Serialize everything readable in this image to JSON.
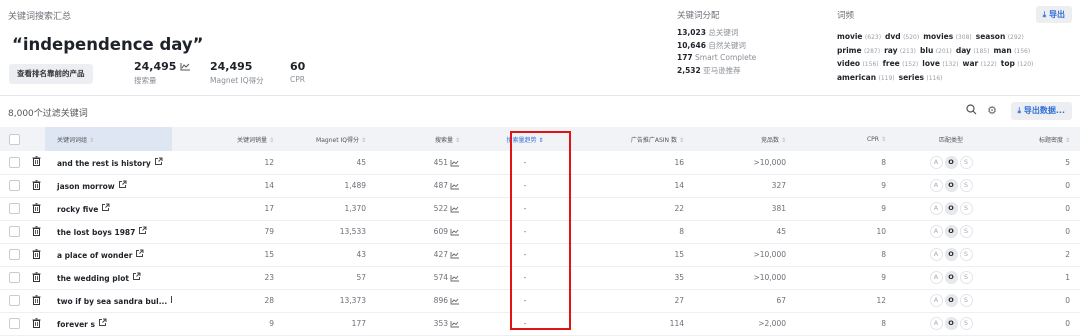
{
  "summary": {
    "title": "关键词搜索汇总",
    "keyword": "“independence day”",
    "top_products_label": "查看排名靠前的产品",
    "search_volume": {
      "value": "24,495",
      "label": "搜索量"
    },
    "magnet_iq": {
      "value": "24,495",
      "label": "Magnet IQ得分"
    },
    "cpr": {
      "value": "60",
      "label": "CPR"
    }
  },
  "distribution": {
    "title": "关键词分配",
    "total": {
      "num": "13,023",
      "text": "总关键词"
    },
    "organic": {
      "num": "10,646",
      "text": "自然关键词"
    },
    "smart": {
      "num": "177",
      "text": "Smart Complete"
    },
    "amazon": {
      "num": "2,532",
      "text": "亚马逊推荐"
    }
  },
  "frequency": {
    "title": "词频",
    "export_label": "导出",
    "rows": [
      [
        {
          "w": "movie",
          "c": "(623)"
        },
        {
          "w": "dvd",
          "c": "(520)"
        },
        {
          "w": "movies",
          "c": "(308)"
        },
        {
          "w": "season",
          "c": "(292)"
        }
      ],
      [
        {
          "w": "prime",
          "c": "(287)"
        },
        {
          "w": "ray",
          "c": "(213)"
        },
        {
          "w": "blu",
          "c": "(201)"
        },
        {
          "w": "day",
          "c": "(185)"
        },
        {
          "w": "man",
          "c": "(156)"
        }
      ],
      [
        {
          "w": "video",
          "c": "(156)"
        },
        {
          "w": "free",
          "c": "(152)"
        },
        {
          "w": "love",
          "c": "(132)"
        },
        {
          "w": "war",
          "c": "(122)"
        },
        {
          "w": "top",
          "c": "(120)"
        }
      ],
      [
        {
          "w": "american",
          "c": "(119)"
        },
        {
          "w": "series",
          "c": "(116)"
        }
      ]
    ]
  },
  "toolbar": {
    "filter_count": "8,000个过滤关键词",
    "export_data_label": "导出数据..."
  },
  "icons": {
    "search": "search-icon",
    "settings": "gear-icon",
    "download": "download-icon",
    "trash": "trash-icon",
    "external": "external-link-icon",
    "trend": "trend-chart-icon"
  },
  "colors": {
    "accent": "#2f6fd6",
    "highlight": "#e01414"
  },
  "table": {
    "headers": {
      "keyword": "关键词词组",
      "sales": "关键词销量",
      "iq": "Magnet IQ得分",
      "volume": "搜索量",
      "trend": "搜索量趋势",
      "asin": "广告推广ASIN 数",
      "products": "竞品数",
      "cpr": "CPR",
      "match": "匹配类型",
      "title_density": "标题密度"
    },
    "match_letters": [
      "A",
      "O",
      "S"
    ],
    "rows": [
      {
        "keyword": "and the rest is history",
        "sales": "12",
        "iq": "45",
        "volume": "451",
        "trend": "-",
        "asin": "16",
        "products": ">10,000",
        "cpr": "8",
        "density": "5"
      },
      {
        "keyword": "jason morrow",
        "sales": "14",
        "iq": "1,489",
        "volume": "487",
        "trend": "-",
        "asin": "14",
        "products": "327",
        "cpr": "9",
        "density": "0"
      },
      {
        "keyword": "rocky five",
        "sales": "17",
        "iq": "1,370",
        "volume": "522",
        "trend": "-",
        "asin": "22",
        "products": "381",
        "cpr": "9",
        "density": "0"
      },
      {
        "keyword": "the lost boys 1987",
        "sales": "79",
        "iq": "13,533",
        "volume": "609",
        "trend": "-",
        "asin": "8",
        "products": "45",
        "cpr": "10",
        "density": "0"
      },
      {
        "keyword": "a place of wonder",
        "sales": "15",
        "iq": "43",
        "volume": "427",
        "trend": "-",
        "asin": "15",
        "products": ">10,000",
        "cpr": "8",
        "density": "2"
      },
      {
        "keyword": "the wedding plot",
        "sales": "23",
        "iq": "57",
        "volume": "574",
        "trend": "-",
        "asin": "35",
        "products": ">10,000",
        "cpr": "9",
        "density": "1"
      },
      {
        "keyword": "two if by sea sandra bul...",
        "sales": "28",
        "iq": "13,373",
        "volume": "896",
        "trend": "-",
        "asin": "27",
        "products": "67",
        "cpr": "12",
        "density": "0"
      },
      {
        "keyword": "forever s",
        "sales": "9",
        "iq": "177",
        "volume": "353",
        "trend": "-",
        "asin": "114",
        "products": ">2,000",
        "cpr": "8",
        "density": "0"
      }
    ]
  }
}
